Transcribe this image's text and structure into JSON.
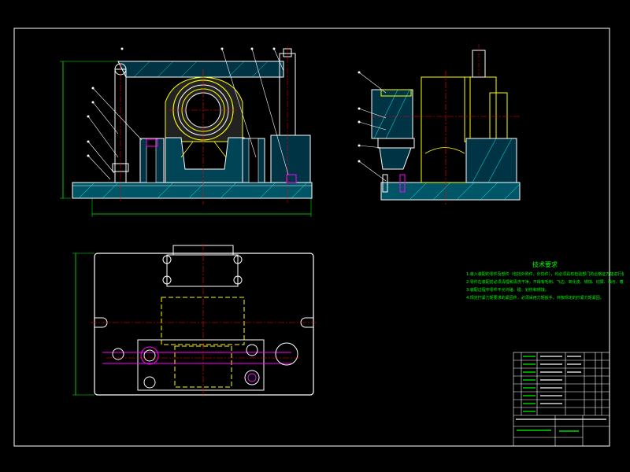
{
  "colors": {
    "background": "#000000",
    "outline": "#ffffff",
    "hatch": "#00ffff",
    "dimension": "#00ff00",
    "centerline": "#ff0000",
    "hidden": "#ffff00",
    "fastener": "#ff00ff"
  },
  "technical_notes": {
    "title": "技术要求",
    "lines": [
      "1.装入装配的零件及部件（包括外购件、外协件），均必须具有检验部门的合格证方能进行装配。",
      "2.零件在装配前必须清理和清洗干净，不得有毛刺、飞边、氧化皮、锈蚀、切屑、油污、着色剂和灰尘等。",
      "3.装配过程中零件不允许磕、碰、划伤和锈蚀。",
      "4.规定拧紧力矩要求的紧固件，必须采用力矩扳手，并按规定的拧紧力矩紧固。"
    ]
  }
}
